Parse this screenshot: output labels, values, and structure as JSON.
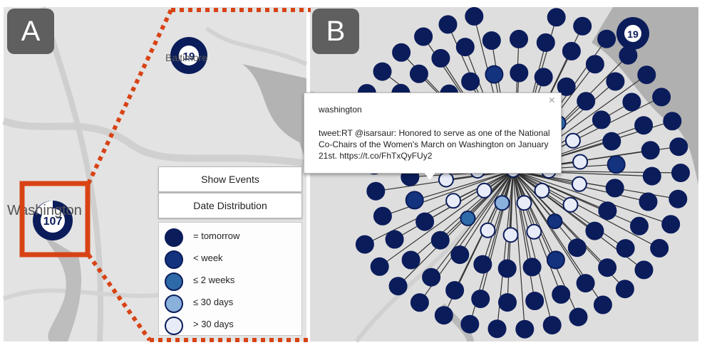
{
  "panels": {
    "a": "A",
    "b": "B"
  },
  "map_a": {
    "labels": {
      "city_1": "Baltimore",
      "city_2": "Washington"
    },
    "clusters": {
      "washington_count": "107",
      "baltimore_count": "19"
    }
  },
  "controls": {
    "show_events": "Show Events",
    "date_distribution": "Date Distribution"
  },
  "legend": {
    "items": [
      {
        "label": "= tomorrow",
        "color": "#0b1c5b"
      },
      {
        "label": "< week",
        "color": "#13337e"
      },
      {
        "label": "≤ 2 weeks",
        "color": "#2f6aa8"
      },
      {
        "label": "≤ 30 days",
        "color": "#8ab0dc"
      },
      {
        "label": "> 30 days",
        "color": "#e8ecf8"
      }
    ]
  },
  "map_b": {
    "cluster_count": "19"
  },
  "tooltip": {
    "title": "washington",
    "body": "tweet:RT @isarsaur: Honored to serve as one of the National Co-Chairs of the Women's March on Washington on January 21st. https://t.co/FhTxQyFUy2",
    "close": "×"
  },
  "colors": {
    "highlight": "#d84315",
    "dark_node": "#0b1c5b",
    "light_node": "#e8ecf8",
    "panel_tag": "#5f5f5f"
  }
}
